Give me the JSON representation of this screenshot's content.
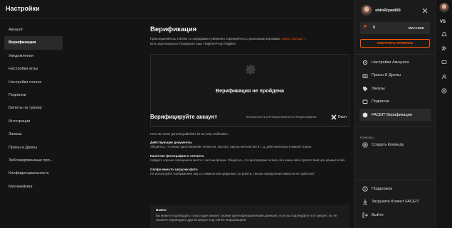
{
  "header": {
    "title": "Настройки"
  },
  "sidebar": {
    "items": [
      {
        "label": "Аккаунт",
        "active": false
      },
      {
        "label": "Верификация",
        "active": true
      },
      {
        "label": "Уведомления",
        "active": false
      },
      {
        "label": "Настройки игры",
        "active": false
      },
      {
        "label": "Настройки голоса",
        "active": false
      },
      {
        "label": "Подписки",
        "active": false
      },
      {
        "label": "Билеты на турнир",
        "active": false
      },
      {
        "label": "Интеграции",
        "active": false
      },
      {
        "label": "Заказы",
        "active": false
      },
      {
        "label": "Призы и Дропы",
        "active": false
      },
      {
        "label": "Заблокированные про...",
        "active": false
      },
      {
        "label": "Конфиденциальность",
        "active": false
      },
      {
        "label": "Матчмейкинг",
        "active": false
      }
    ]
  },
  "main": {
    "title": "Верификация",
    "intro": "Присоединяйтесь к битве со смурфами и уверенно соревнуйтесь с реальными игроками.",
    "learn_more": "Узнать больше",
    "faq": "Есть еще вопросы? Проверьте наш <Taglink>FAQ</Taglink>",
    "not_verified": "Верификация не пройдена",
    "verify_heading": "Верифицируйте аккаунт",
    "powered_by": "БЕЗОПАСНОСТЬ И ФУНКЦИОНАЛЬНОСТЬ ПРЕДОСТАВЛЕНЫ",
    "provider": "Daon",
    "guidelines_intro": "Here are some general guidelines for an easy verification.",
    "guidelines": [
      {
        "title": "Действующие документы",
        "text": "Убедитесь, что ваше удостоверение личности, паспорт, вид на жительство и т. д. действительны в вашей стране."
      },
      {
        "title": "Качество фотографии и четкость",
        "text": "Найдите хорошо освещенное место с чистым фоном. Убедитесь, что фотография четкая, без каких-либо препятствий или размытостей."
      },
      {
        "title": "Селфи вместо загрузки фото",
        "text": "Не используйте изображения лиц со снимков или цифровых устройств, так как определение живости не сработает."
      }
    ],
    "important": {
      "title": "Важно",
      "text": "Вы можете подтвердить только один аккаунт своими идентификационными данными, если вы подтвердите этот аккаунт, вы не сможете подтвердить другой аккаунт под той же информацией."
    }
  },
  "account_panel": {
    "username": "sbinRiyadi00",
    "wallet_icon": "F",
    "balance": "0",
    "shop_label": "МАГАЗИН",
    "view_profile": "СМОТРЕТЬ ПРОФИЛЬ",
    "menu": [
      {
        "label": "Настройки Аккаунта",
        "icon": "gear-icon",
        "active": false
      },
      {
        "label": "Призы И Дропы",
        "icon": "gift-icon",
        "active": false
      },
      {
        "label": "Заказы",
        "icon": "tag-icon",
        "active": false
      },
      {
        "label": "Подписки",
        "icon": "subscription-icon",
        "active": false
      },
      {
        "label": "FACEIT Верификация",
        "icon": "verify-badge-icon",
        "active": true
      }
    ],
    "teams_label": "Команды",
    "create_team": "Создать Команду",
    "footer": [
      {
        "label": "Поддержка",
        "icon": "info-icon"
      },
      {
        "label": "Загрузите Клиент FACEIT",
        "icon": "download-icon"
      },
      {
        "label": "Выйти",
        "icon": "logout-icon"
      }
    ]
  },
  "rail": {
    "vs_label": "VS"
  },
  "colors": {
    "accent": "#ff5500",
    "background": "#141414",
    "panel": "#1b1b1b"
  }
}
